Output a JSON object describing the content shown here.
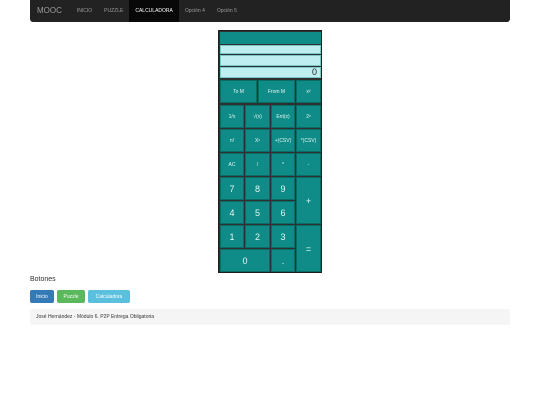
{
  "navbar": {
    "brand": "MOOC",
    "items": [
      {
        "label": "INICIO"
      },
      {
        "label": "PUZZLE"
      },
      {
        "label": "CALCULADORA"
      },
      {
        "label": "Opción 4"
      },
      {
        "label": "Opción 5"
      }
    ]
  },
  "calculator": {
    "display_value": "0",
    "buttons": {
      "to_m": "To M",
      "from_m": "From M",
      "x2": "x²",
      "inv": "1/x",
      "sqrt": "√(x)",
      "entx": "Ent(x)",
      "pow2": "2ˣ",
      "fact": "n!",
      "xy": "Xʸ",
      "sum_csv": "+(CSV)",
      "mul_csv": "*(CSV)",
      "ac": "AC",
      "div": "/",
      "mul": "*",
      "minus": "-",
      "n7": "7",
      "n8": "8",
      "n9": "9",
      "n4": "4",
      "n5": "5",
      "n6": "6",
      "n1": "1",
      "n2": "2",
      "n3": "3",
      "plus": "+",
      "n0": "0",
      "dot": ".",
      "eq": "="
    }
  },
  "section": {
    "title": "Botones"
  },
  "buttons": {
    "inicio": "Inicio",
    "puzzle": "Puzzle",
    "calculadora": "Calculadora"
  },
  "footer": {
    "text": "José Hernández - Módulo 6. P2P Entrega Obligatoria"
  },
  "colors": {
    "calc_button": "#0f8c87",
    "display_bg": "#bfeef0",
    "inicio": "#337ab7",
    "puzzle": "#5cb85c",
    "calculadora": "#5bc0de"
  }
}
